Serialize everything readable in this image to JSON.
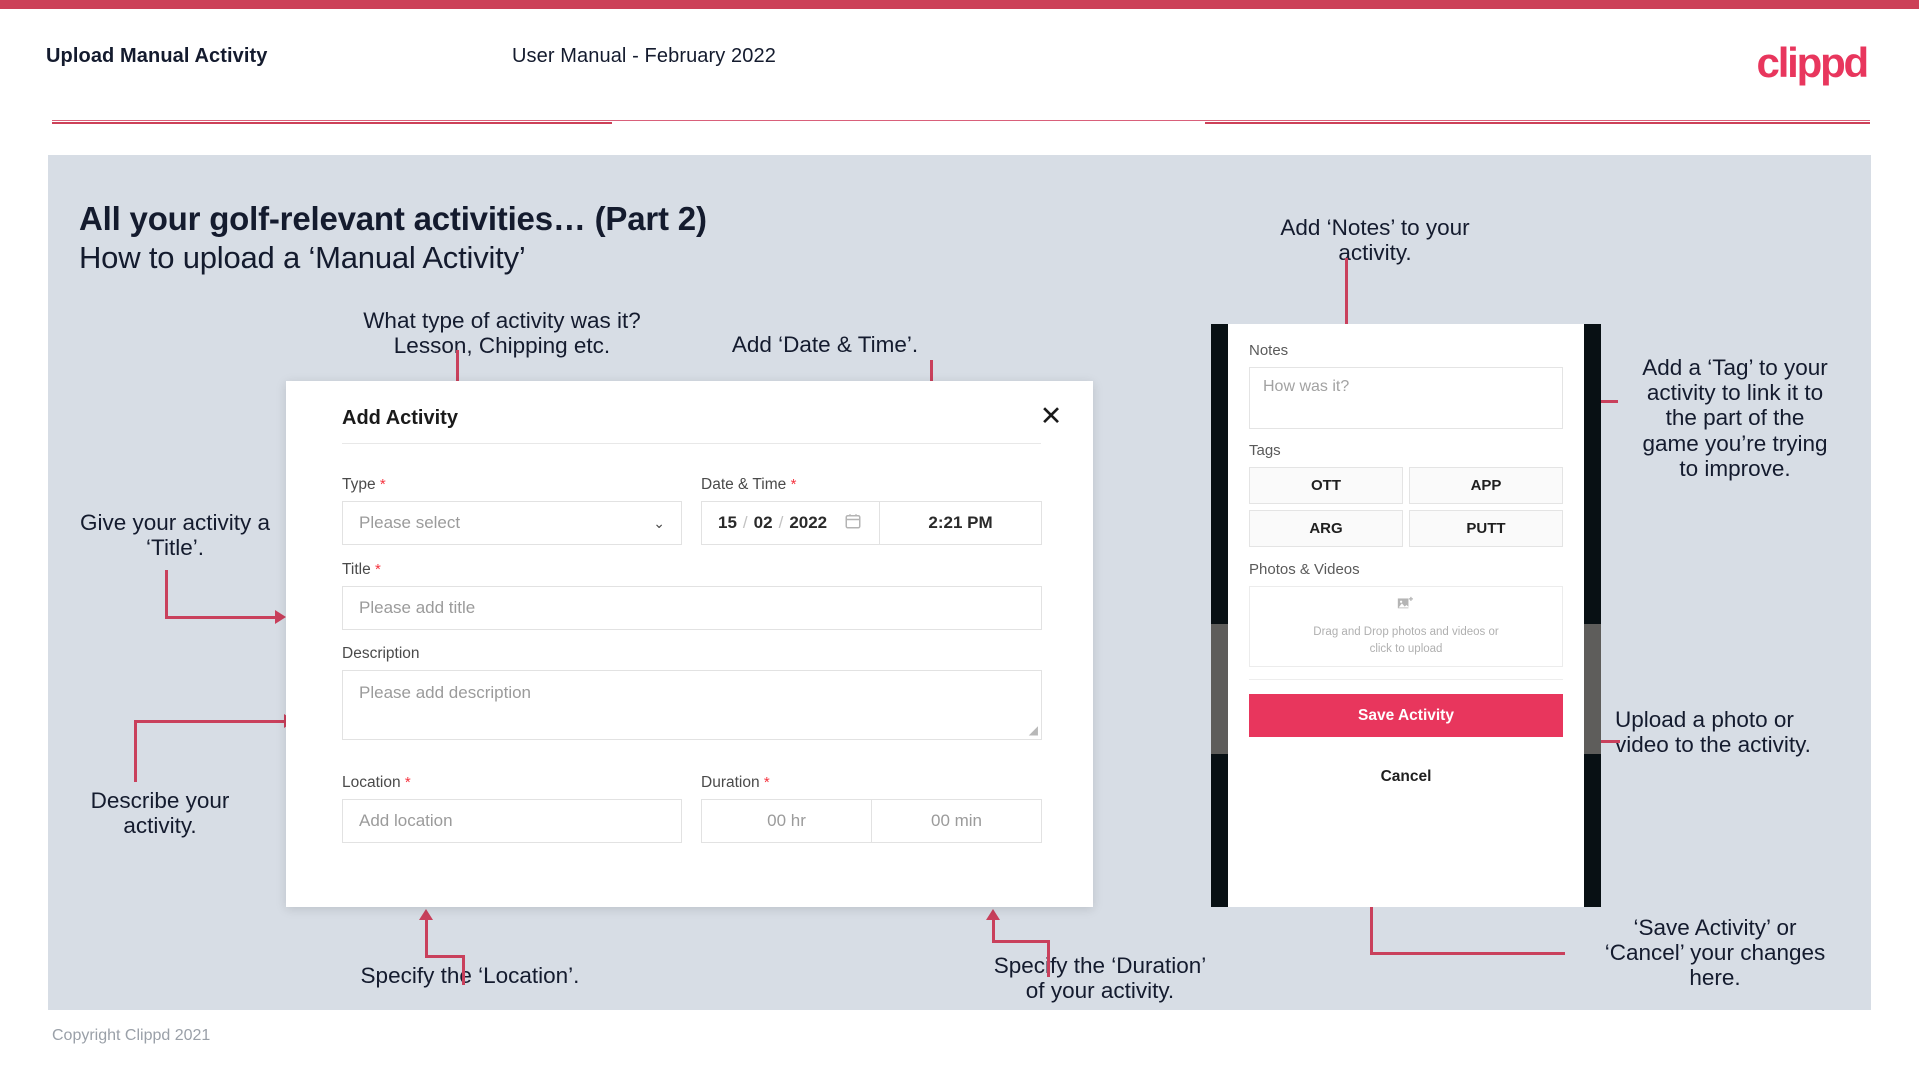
{
  "header": {
    "title": "Upload Manual Activity",
    "subtitle": "User Manual - February 2022",
    "logo": "clippd"
  },
  "slide": {
    "title": "All your golf-relevant activities… (Part 2)",
    "subtitle": "How to upload a ‘Manual Activity’"
  },
  "footer": {
    "copyright": "Copyright Clippd 2021"
  },
  "annotations": {
    "type": "What type of activity was it?\nLesson, Chipping etc.",
    "datetime": "Add ‘Date & Time’.",
    "title": "Give your activity a\n‘Title’.",
    "description": "Describe your\nactivity.",
    "location": "Specify the ‘Location’.",
    "duration": "Specify the ‘Duration’\nof your activity.",
    "notes": "Add ‘Notes’ to your\nactivity.",
    "tag": "Add a ‘Tag’ to your\nactivity to link it to\nthe part of the\ngame you’re trying\nto improve.",
    "upload": "Upload a photo or\nvideo to the activity.",
    "save": "‘Save Activity’ or\n‘Cancel’ your changes\nhere."
  },
  "dialog": {
    "title": "Add Activity",
    "close_icon": "✕",
    "type": {
      "label": "Type",
      "required": "*",
      "placeholder": "Please select",
      "chevron": "⌄"
    },
    "datetime": {
      "label": "Date & Time",
      "required": "*",
      "day": "15",
      "month": "02",
      "year": "2022",
      "sep": "/",
      "time": "2:21 PM"
    },
    "title_field": {
      "label": "Title",
      "required": "*",
      "placeholder": "Please add title"
    },
    "description": {
      "label": "Description",
      "placeholder": "Please add description"
    },
    "location": {
      "label": "Location",
      "required": "*",
      "placeholder": "Add location"
    },
    "duration": {
      "label": "Duration",
      "required": "*",
      "hours": "00 hr",
      "minutes": "00 min"
    }
  },
  "phone": {
    "notes": {
      "label": "Notes",
      "placeholder": "How was it?"
    },
    "tags": {
      "label": "Tags",
      "items": [
        "OTT",
        "APP",
        "ARG",
        "PUTT"
      ]
    },
    "photos": {
      "label": "Photos & Videos",
      "drop_line1": "Drag and Drop photos and videos or",
      "drop_line2": "click to upload"
    },
    "save_label": "Save Activity",
    "cancel_label": "Cancel"
  },
  "colors": {
    "accent": "#e8365d",
    "bar": "#cc4158",
    "slide_bg": "#d7dde5",
    "ink": "#141b2e",
    "annotation_line": "#c9405c"
  }
}
